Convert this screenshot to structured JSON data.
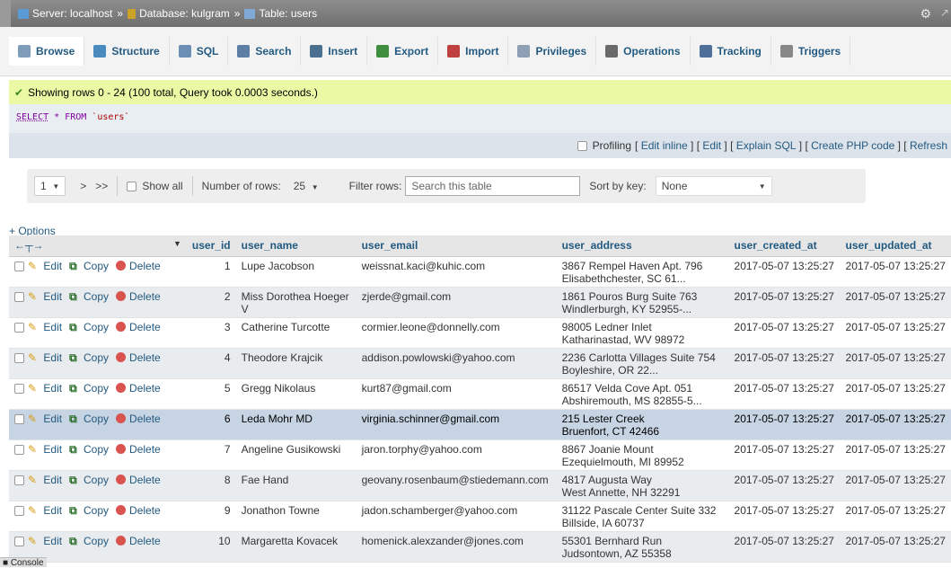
{
  "breadcrumb": {
    "server": "Server: localhost",
    "database": "Database: kulgram",
    "table": "Table: users",
    "sep": "»"
  },
  "tabs": [
    {
      "label": "Browse",
      "icon": "browse-icon",
      "active": true
    },
    {
      "label": "Structure",
      "icon": "structure-icon"
    },
    {
      "label": "SQL",
      "icon": "sql-icon"
    },
    {
      "label": "Search",
      "icon": "search-icon"
    },
    {
      "label": "Insert",
      "icon": "insert-icon"
    },
    {
      "label": "Export",
      "icon": "export-icon"
    },
    {
      "label": "Import",
      "icon": "import-icon"
    },
    {
      "label": "Privileges",
      "icon": "privileges-icon"
    },
    {
      "label": "Operations",
      "icon": "operations-icon"
    },
    {
      "label": "Tracking",
      "icon": "tracking-icon"
    },
    {
      "label": "Triggers",
      "icon": "triggers-icon"
    }
  ],
  "message": "Showing rows 0 - 24 (100 total, Query took 0.0003 seconds.)",
  "sql": {
    "select": "SELECT",
    "rest": " * FROM ",
    "table": "`users`"
  },
  "profile": {
    "profiling": "Profiling",
    "links": [
      "Edit inline",
      "Edit",
      "Explain SQL",
      "Create PHP code",
      "Refresh"
    ]
  },
  "nav": {
    "page": "1",
    "next": ">",
    "last": ">>",
    "show_all": "Show all",
    "rows_label": "Number of rows:",
    "rows_value": "25",
    "filter_label": "Filter rows:",
    "filter_placeholder": "Search this table",
    "sort_label": "Sort by key:",
    "sort_value": "None"
  },
  "options": "+ Options",
  "columns": [
    "user_id",
    "user_name",
    "user_email",
    "user_address",
    "user_created_at",
    "user_updated_at"
  ],
  "actions": {
    "edit": "Edit",
    "copy": "Copy",
    "delete": "Delete"
  },
  "rows": [
    {
      "id": "1",
      "name": "Lupe Jacobson",
      "name2": "",
      "email": "weissnat.kaci@kuhic.com",
      "addr1": "3867 Rempel Haven Apt. 796",
      "addr2": "Elisabethchester, SC 61...",
      "created": "2017-05-07 13:25:27",
      "updated": "2017-05-07 13:25:27"
    },
    {
      "id": "2",
      "name": "Miss Dorothea Hoeger",
      "name2": "V",
      "email": "zjerde@gmail.com",
      "addr1": "1861 Pouros Burg Suite 763",
      "addr2": "Windlerburgh, KY 52955-...",
      "created": "2017-05-07 13:25:27",
      "updated": "2017-05-07 13:25:27"
    },
    {
      "id": "3",
      "name": "Catherine Turcotte",
      "name2": "",
      "email": "cormier.leone@donnelly.com",
      "addr1": "98005 Ledner Inlet",
      "addr2": "Katharinastad, WV 98972",
      "created": "2017-05-07 13:25:27",
      "updated": "2017-05-07 13:25:27"
    },
    {
      "id": "4",
      "name": "Theodore Krajcik",
      "name2": "",
      "email": "addison.powlowski@yahoo.com",
      "addr1": "2236 Carlotta Villages Suite 754",
      "addr2": "Boyleshire, OR 22...",
      "created": "2017-05-07 13:25:27",
      "updated": "2017-05-07 13:25:27"
    },
    {
      "id": "5",
      "name": "Gregg Nikolaus",
      "name2": "",
      "email": "kurt87@gmail.com",
      "addr1": "86517 Velda Cove Apt. 051",
      "addr2": "Abshiremouth, MS 82855-5...",
      "created": "2017-05-07 13:25:27",
      "updated": "2017-05-07 13:25:27"
    },
    {
      "id": "6",
      "name": "Leda Mohr MD",
      "name2": "",
      "email": "virginia.schinner@gmail.com",
      "addr1": "215 Lester Creek",
      "addr2": "Bruenfort, CT 42466",
      "created": "2017-05-07 13:25:27",
      "updated": "2017-05-07 13:25:27"
    },
    {
      "id": "7",
      "name": "Angeline Gusikowski",
      "name2": "",
      "email": "jaron.torphy@yahoo.com",
      "addr1": "8867 Joanie Mount",
      "addr2": "Ezequielmouth, MI 89952",
      "created": "2017-05-07 13:25:27",
      "updated": "2017-05-07 13:25:27"
    },
    {
      "id": "8",
      "name": "Fae Hand",
      "name2": "",
      "email": "geovany.rosenbaum@stiedemann.com",
      "addr1": "4817 Augusta Way",
      "addr2": "West Annette, NH 32291",
      "created": "2017-05-07 13:25:27",
      "updated": "2017-05-07 13:25:27"
    },
    {
      "id": "9",
      "name": "Jonathon Towne",
      "name2": "",
      "email": "jadon.schamberger@yahoo.com",
      "addr1": "31122 Pascale Center Suite 332",
      "addr2": "Billside, IA 60737",
      "created": "2017-05-07 13:25:27",
      "updated": "2017-05-07 13:25:27"
    },
    {
      "id": "10",
      "name": "Margaretta Kovacek",
      "name2": "",
      "email": "homenick.alexzander@jones.com",
      "addr1": "55301 Bernhard Run",
      "addr2": "Judsontown, AZ 55358",
      "created": "2017-05-07 13:25:27",
      "updated": "2017-05-07 13:25:27"
    }
  ],
  "console": "Console",
  "colors": {
    "link": "#235a81",
    "success_bg": "#ebf8a4",
    "highlight_row": "#c7d4e3"
  }
}
